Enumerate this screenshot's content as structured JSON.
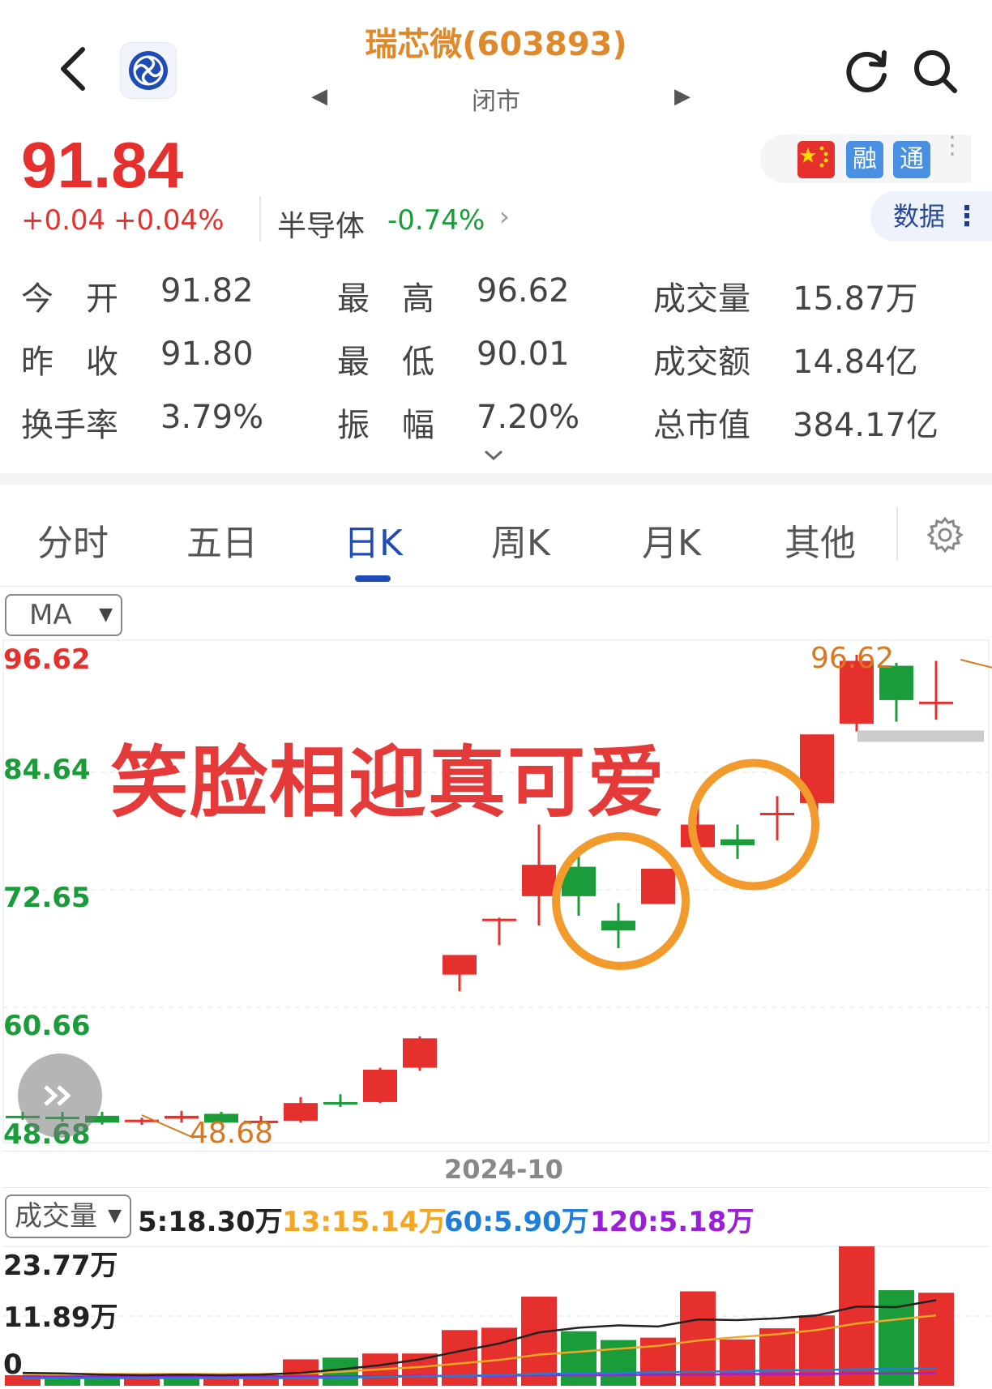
{
  "header": {
    "title": "瑞芯微(603893)",
    "status": "闭市",
    "back_icon": "chevron-left-icon",
    "logo_icon": "broker-logo-icon",
    "refresh_icon": "refresh-icon",
    "search_icon": "search-icon",
    "prev_icon": "triangle-left-icon",
    "next_icon": "triangle-right-icon"
  },
  "quote": {
    "price": "91.84",
    "change": "+0.04",
    "change_pct": "+0.04%",
    "sector_name": "半导体",
    "sector_change": "-0.74%",
    "colors": {
      "up": "#e5302d",
      "down": "#1a9c3a"
    }
  },
  "tags": {
    "flag_icon": "china-flag-icon",
    "rong": "融",
    "tong": "通",
    "data_label": "数据"
  },
  "stats": [
    {
      "label": "今　开",
      "value": "91.82"
    },
    {
      "label": "最　高",
      "value": "96.62"
    },
    {
      "label": "成交量",
      "value": "15.87万"
    },
    {
      "label": "昨　收",
      "value": "91.80"
    },
    {
      "label": "最　低",
      "value": "90.01"
    },
    {
      "label": "成交额",
      "value": "14.84亿"
    },
    {
      "label": "换手率",
      "value": "3.79%"
    },
    {
      "label": "振　幅",
      "value": "7.20%"
    },
    {
      "label": "总市值",
      "value": "384.17亿"
    }
  ],
  "tabs": [
    "分时",
    "五日",
    "日K",
    "周K",
    "月K",
    "其他"
  ],
  "active_tab": "日K",
  "indicator_select": "MA",
  "volume_select": "成交量",
  "annotation": "笑脸相迎真可爱",
  "chart_data": {
    "type": "candlestick",
    "y_axis_labels": [
      "96.62",
      "84.64",
      "72.65",
      "60.66",
      "48.68"
    ],
    "ylim": [
      48.68,
      96.62
    ],
    "x_label": "2024-10",
    "high_marker": "96.62",
    "low_marker": "48.68",
    "candles": [
      {
        "open": 49.6,
        "close": 49.5,
        "high": 50.0,
        "low": 49.2
      },
      {
        "open": 49.5,
        "close": 49.4,
        "high": 50.0,
        "low": 49.0
      },
      {
        "open": 49.6,
        "close": 48.9,
        "high": 50.0,
        "low": 48.7
      },
      {
        "open": 49.0,
        "close": 49.2,
        "high": 49.4,
        "low": 48.68
      },
      {
        "open": 49.3,
        "close": 49.6,
        "high": 50.1,
        "low": 48.9
      },
      {
        "open": 49.8,
        "close": 48.9,
        "high": 50.0,
        "low": 48.8
      },
      {
        "open": 48.9,
        "close": 49.1,
        "high": 49.6,
        "low": 48.7
      },
      {
        "open": 49.1,
        "close": 50.9,
        "high": 51.5,
        "low": 48.9
      },
      {
        "open": 51.0,
        "close": 50.8,
        "high": 51.8,
        "low": 50.5
      },
      {
        "open": 51.0,
        "close": 54.3,
        "high": 54.5,
        "low": 50.9
      },
      {
        "open": 54.5,
        "close": 57.5,
        "high": 57.7,
        "low": 54.2
      },
      {
        "open": 64.0,
        "close": 66.0,
        "high": 66.0,
        "low": 62.3
      },
      {
        "open": 69.7,
        "close": 69.7,
        "high": 69.8,
        "low": 67.0
      },
      {
        "open": 72.0,
        "close": 75.2,
        "high": 79.3,
        "low": 69.0
      },
      {
        "open": 75.0,
        "close": 72.0,
        "high": 77.0,
        "low": 70.0
      },
      {
        "open": 69.5,
        "close": 68.5,
        "high": 71.3,
        "low": 66.7
      },
      {
        "open": 71.2,
        "close": 74.8,
        "high": 74.8,
        "low": 71.2
      },
      {
        "open": 77.0,
        "close": 79.3,
        "high": 82.2,
        "low": 76.2
      },
      {
        "open": 77.8,
        "close": 77.2,
        "high": 79.3,
        "low": 75.8
      },
      {
        "open": 80.5,
        "close": 80.5,
        "high": 82.2,
        "low": 77.7
      },
      {
        "open": 81.5,
        "close": 88.5,
        "high": 88.5,
        "low": 80.5
      },
      {
        "open": 89.6,
        "close": 96.0,
        "high": 96.62,
        "low": 88.8
      },
      {
        "open": 95.5,
        "close": 92.0,
        "high": 95.8,
        "low": 89.8
      },
      {
        "open": 91.8,
        "close": 91.84,
        "high": 96.0,
        "low": 90.01
      }
    ],
    "volume": {
      "labels": [
        "23.77万",
        "11.89万",
        "0"
      ],
      "ylim": [
        0,
        23.77
      ],
      "ma_lines": [
        {
          "name": "5",
          "value": "5:18.30万",
          "color": "#222222"
        },
        {
          "name": "13",
          "value": "13:15.14万",
          "color": "#f5a623"
        },
        {
          "name": "60",
          "value": "60:5.90万",
          "color": "#1f7fd8"
        },
        {
          "name": "120",
          "value": "120:5.18万",
          "color": "#9b1fd8"
        }
      ],
      "bars": [
        1.8,
        1.6,
        1.5,
        1.8,
        2.0,
        1.8,
        1.8,
        4.5,
        4.8,
        5.5,
        5.5,
        9.5,
        9.9,
        15.2,
        9.3,
        7.8,
        8.2,
        16.1,
        7.9,
        9.8,
        12.0,
        23.77,
        16.3,
        15.87
      ],
      "bar_up": [
        1,
        0,
        0,
        1,
        0,
        1,
        1,
        1,
        0,
        1,
        1,
        1,
        1,
        1,
        0,
        0,
        1,
        1,
        1,
        1,
        1,
        1,
        0,
        1
      ],
      "ma5": [
        2.2,
        2.1,
        1.9,
        1.8,
        1.9,
        1.8,
        1.9,
        2.2,
        2.8,
        3.5,
        4.5,
        5.9,
        7.2,
        9.1,
        9.9,
        10.3,
        10.1,
        11.3,
        11.2,
        11.5,
        12.0,
        13.5,
        13.4,
        14.6
      ],
      "ma13": [
        2.0,
        2.0,
        2.0,
        2.0,
        2.0,
        2.0,
        2.0,
        2.1,
        2.4,
        2.8,
        3.2,
        3.8,
        4.4,
        5.3,
        5.8,
        6.3,
        6.8,
        7.7,
        8.3,
        8.8,
        9.5,
        10.6,
        11.3,
        12.0
      ],
      "ma60": [
        1.3,
        1.3,
        1.3,
        1.3,
        1.3,
        1.3,
        1.3,
        1.3,
        1.4,
        1.5,
        1.6,
        1.7,
        1.8,
        2.0,
        2.1,
        2.2,
        2.3,
        2.4,
        2.5,
        2.6,
        2.7,
        2.8,
        2.9,
        3.0
      ],
      "ma120": [
        1.6,
        1.6,
        1.6,
        1.6,
        1.6,
        1.6,
        1.6,
        1.6,
        1.6,
        1.6,
        1.7,
        1.7,
        1.7,
        1.8,
        1.8,
        1.8,
        1.9,
        1.9,
        2.0,
        2.0,
        2.0,
        2.1,
        2.1,
        2.2
      ]
    }
  },
  "circles": [
    "circle-1",
    "circle-2"
  ],
  "fast_forward_icon": "fast-forward-icon",
  "expand_icon": "chevron-down-icon",
  "settings_icon": "gear-icon"
}
